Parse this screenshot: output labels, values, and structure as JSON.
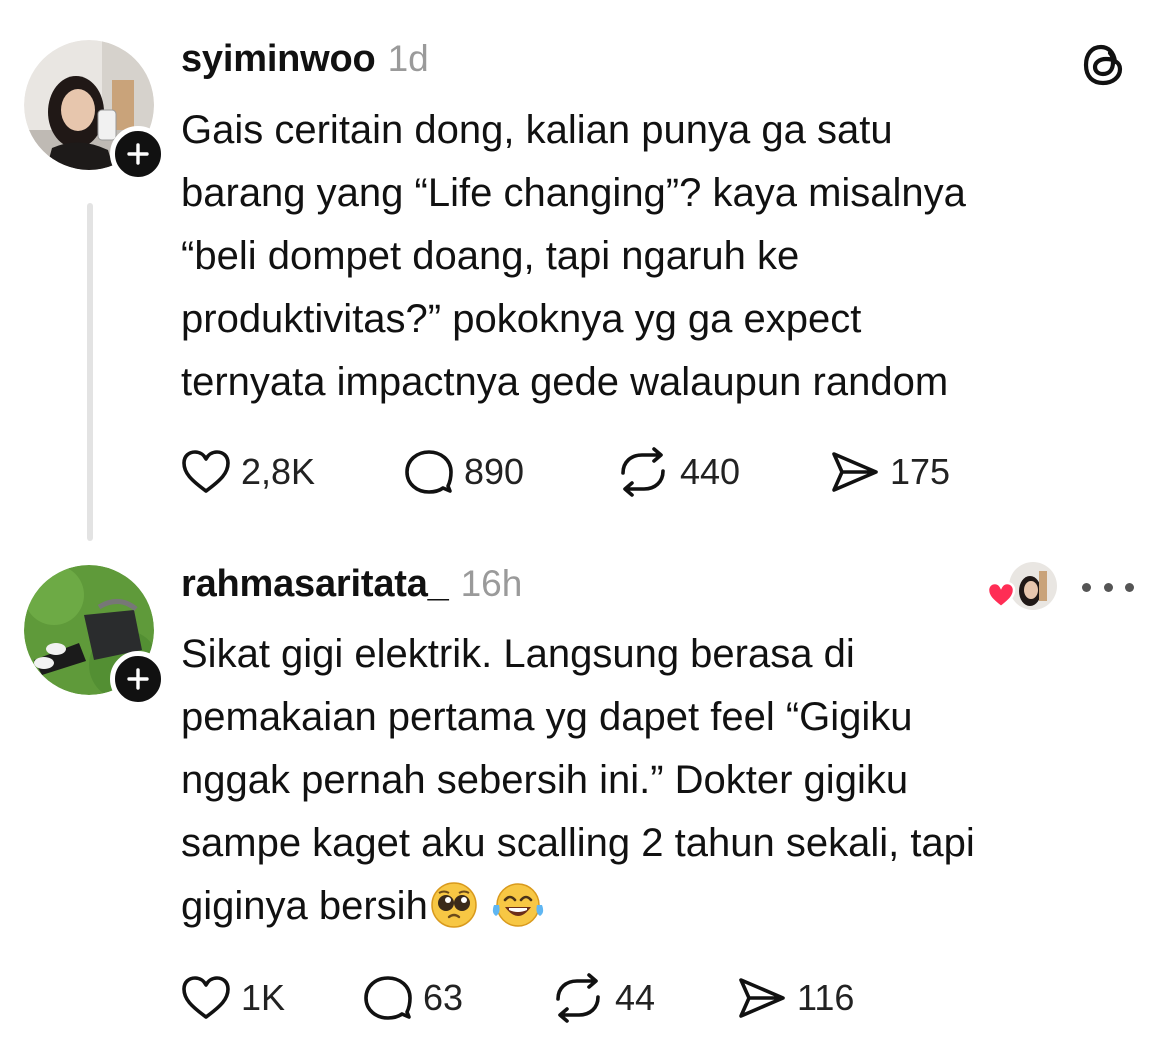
{
  "posts": [
    {
      "username": "syiminwoo",
      "time": "1d",
      "text": "Gais ceritain dong, kalian punya ga satu\nbarang yang “Life changing”? kaya misalnya\n“beli dompet doang, tapi ngaruh ke\nproduktivitas?” pokoknya yg ga expect\nternyata impactnya gede walaupun random",
      "stats": {
        "likes": "2,8K",
        "replies": "890",
        "reposts": "440",
        "shares": "175"
      }
    },
    {
      "username": "rahmasaritata_",
      "time": "16h",
      "text": "Sikat gigi elektrik. Langsung berasa di\npemakaian pertama yg dapet feel “Gigiku\nnggak pernah sebersih ini.” Dokter gigiku\nsampe kaget aku scalling 2 tahun sekali, tapi\ngiginya bersih",
      "emojis": [
        "pleading-face",
        "tears-of-joy-face"
      ],
      "stats": {
        "likes": "1K",
        "replies": "63",
        "reposts": "44",
        "shares": "116"
      }
    }
  ],
  "icons": {
    "app_logo": "threads-logo-icon",
    "follow": "plus-icon",
    "like": "heart-icon",
    "reply": "comment-bubble-icon",
    "repost": "repost-icon",
    "share": "send-icon",
    "more": "more-dots-icon",
    "liked_by_author": "red-heart-icon"
  },
  "colors": {
    "text": "#111111",
    "muted": "#9a9a9a",
    "thread_line": "#e3e3e3",
    "heart_red": "#ff2d55"
  }
}
